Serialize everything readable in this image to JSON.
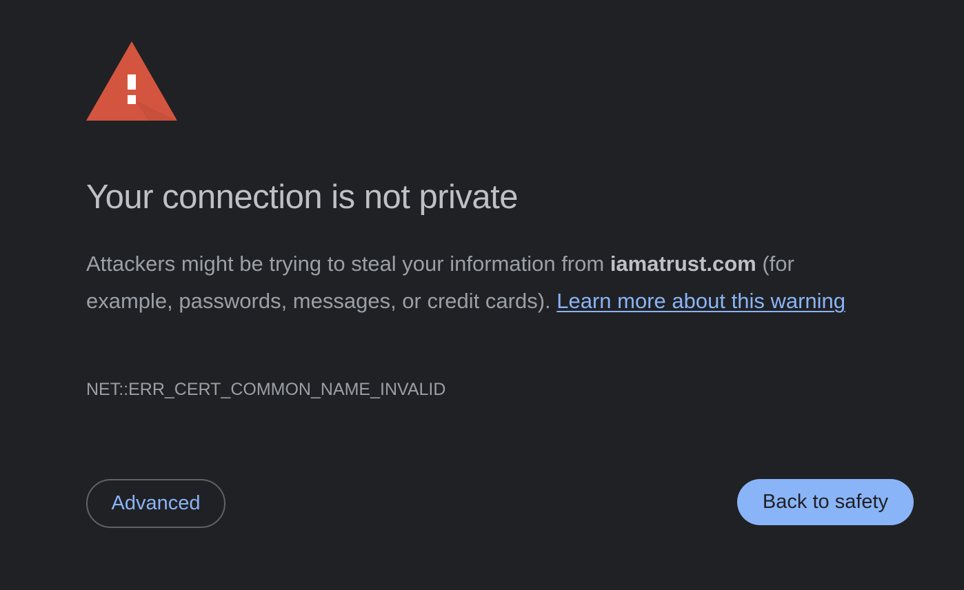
{
  "interstitial": {
    "icon": "warning-triangle-icon",
    "icon_color": "#d4553f",
    "title": "Your connection is not private",
    "explanation_prefix": "Attackers might be trying to steal your information from ",
    "host": "iamatrust.com",
    "explanation_suffix": " (for example, passwords, messages, or credit cards). ",
    "learn_more_link": "Learn more about this warning",
    "error_code": "NET::ERR_CERT_COMMON_NAME_INVALID"
  },
  "buttons": {
    "advanced_label": "Advanced",
    "back_to_safety_label": "Back to safety"
  },
  "colors": {
    "background": "#202124",
    "link": "#8ab4f8",
    "primary_button": "#8ab4f8"
  }
}
